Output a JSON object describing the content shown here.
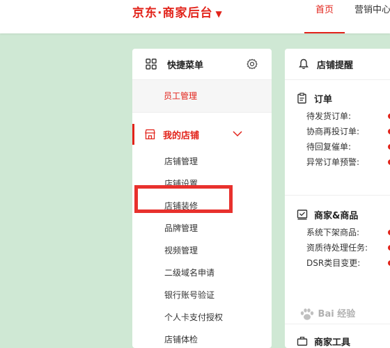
{
  "header": {
    "brand": "京东·商家后台",
    "brand_caret": "▼",
    "nav_home": "首页",
    "nav_marketing": "营销中心"
  },
  "quick_menu": {
    "title": "快捷菜单",
    "items": [
      "员工管理"
    ]
  },
  "store_menu": {
    "label": "我的店铺",
    "items": [
      "店铺管理",
      "店铺设置",
      "店铺装修",
      "品牌管理",
      "视频管理",
      "二级域名申请",
      "银行账号验证",
      "个人卡支付授权",
      "店铺体检"
    ]
  },
  "alerts": {
    "title": "店铺提醒",
    "order_title": "订单",
    "order_rows": [
      "待发货订单:",
      "协商再投订单:",
      "待回复催单:",
      "异常订单预警:"
    ],
    "goods_title": "商家&商品",
    "goods_rows": [
      "系统下架商品:",
      "资质待处理任务:",
      "DSR类目变更:"
    ],
    "tools_title": "商家工具"
  },
  "watermark": "Bai 经验",
  "colors": {
    "accent": "#e2231a",
    "background": "#cfe8d4",
    "highlight": "#e8312d"
  }
}
